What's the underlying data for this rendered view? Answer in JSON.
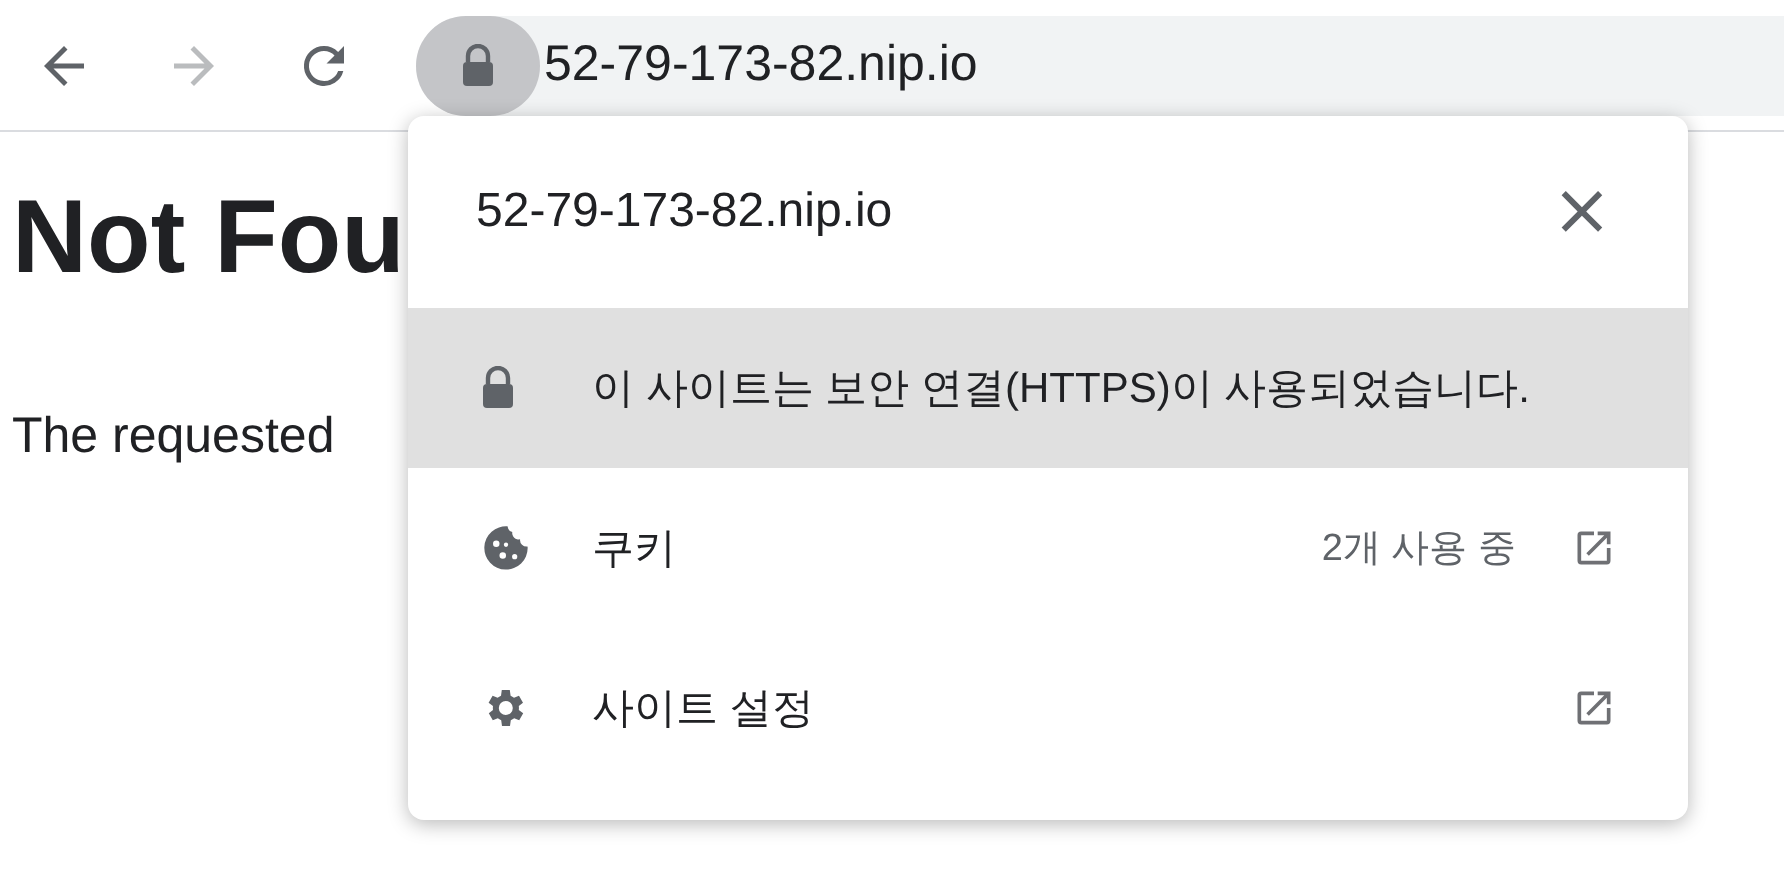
{
  "toolbar": {
    "buttons": [
      {
        "kind": "back",
        "disabled": false
      },
      {
        "kind": "forward",
        "disabled": true
      },
      {
        "kind": "reload",
        "disabled": false
      }
    ],
    "address": "52-79-173-82.nip.io"
  },
  "page": {
    "heading": "Not Fou",
    "text": "The requested"
  },
  "popup": {
    "title": "52-79-173-82.nip.io",
    "close": "×",
    "rows": [
      {
        "kind": "lock",
        "label": "이 사이트는 보안 연결(HTTPS)이 사용되었습니다.",
        "selected": true
      },
      {
        "kind": "cookie",
        "label": "쿠키",
        "detail": "2개 사용 중",
        "link": true,
        "selected": false
      },
      {
        "kind": "gear",
        "label": "사이트 설정",
        "link": true,
        "selected": false
      }
    ]
  }
}
